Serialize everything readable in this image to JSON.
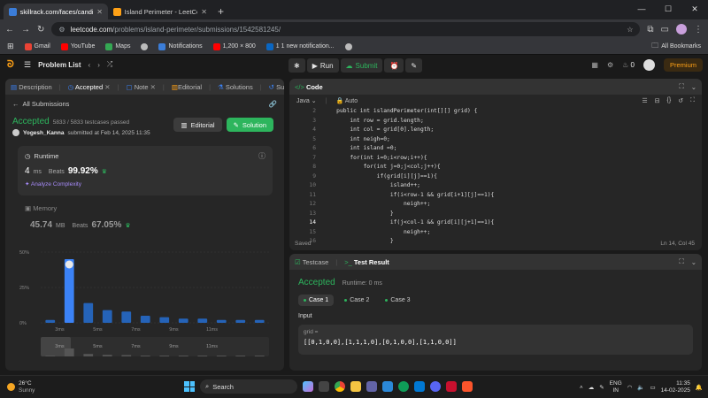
{
  "browser": {
    "tabs": [
      {
        "title": "skillrack.com/faces/candidate/",
        "active": true,
        "color": "#3b7dd8"
      },
      {
        "title": "Island Perimeter - LeetCode",
        "active": false,
        "color": "#ffa116"
      }
    ],
    "url_host": "leetcode.com",
    "url_path": "/problems/island-perimeter/submissions/1542581245/",
    "bookmarks": [
      {
        "label": "Gmail",
        "color": "#ea4335"
      },
      {
        "label": "YouTube",
        "color": "#ff0000"
      },
      {
        "label": "Maps",
        "color": "#34a853"
      },
      {
        "label": "",
        "color": "#bbbbbb"
      },
      {
        "label": "Notifications",
        "color": "#3b7dd8"
      },
      {
        "label": "1,200 × 800",
        "color": "#ff0000"
      },
      {
        "label": "1 1 new notification...",
        "color": "#0a66c2"
      },
      {
        "label": "",
        "color": "#bbbbbb"
      }
    ],
    "all_bookmarks": "All Bookmarks"
  },
  "topnav": {
    "problem_list": "Problem List",
    "run": "Run",
    "submit": "Submit",
    "streak": "0",
    "premium": "Premium"
  },
  "left": {
    "tabs": [
      "Description",
      "Accepted",
      "Note",
      "Editorial",
      "Solutions",
      "Submissions"
    ],
    "all_submissions": "All Submissions",
    "status": "Accepted",
    "testcases": "5833 / 5833 testcases passed",
    "user": "Yogesh_Kanna",
    "submitted": "submitted at Feb 14, 2025 11:35",
    "editorial_btn": "Editorial",
    "solution_btn": "Solution",
    "runtime": {
      "label": "Runtime",
      "value": "4",
      "unit": "ms",
      "beats_label": "Beats",
      "beats": "99.92%",
      "analyze": "Analyze Complexity"
    },
    "memory": {
      "label": "Memory",
      "value": "45.74",
      "unit": "MB",
      "beats_label": "Beats",
      "beats": "67.05%"
    }
  },
  "chart_data": {
    "type": "bar",
    "categories": [
      "1",
      "2",
      "3",
      "4",
      "5",
      "6",
      "7",
      "8",
      "9",
      "10",
      "11",
      "12"
    ],
    "values": [
      2,
      45,
      14,
      9,
      8,
      5,
      4,
      3,
      3,
      2,
      2,
      2
    ],
    "highlight_index": 1,
    "ylim": [
      0,
      50
    ],
    "y_ticks": [
      "50%",
      "25%",
      "0%"
    ],
    "x_tick_labels": [
      "3ms",
      "5ms",
      "7ms",
      "9ms",
      "11ms"
    ],
    "range_labels": [
      "3ms",
      "5ms",
      "7ms",
      "9ms",
      "11ms"
    ]
  },
  "code": {
    "title": "Code",
    "language": "Java",
    "mode": "Auto",
    "start_line": 2,
    "current_line": 14,
    "lines": [
      "    public int islandPerimeter(int[][] grid) {",
      "        int row = grid.length;",
      "        int col = grid[0].length;",
      "        int neigh=0;",
      "        int island =0;",
      "        for(int i=0;i<row;i++){",
      "            for(int j=0;j<col;j++){",
      "                if(grid[i][j]==1){",
      "                    island++;",
      "                    if(i<row-1 && grid[i+1][j]==1){",
      "                        neigh++;",
      "                    }",
      "                    if(j<col-1 && grid[i][j+1]==1){",
      "                        neigh++;",
      "                    }"
    ],
    "saved": "Saved",
    "cursor": "Ln 14, Col 45"
  },
  "testresult": {
    "tab_testcase": "Testcase",
    "tab_result": "Test Result",
    "status": "Accepted",
    "runtime": "Runtime: 0 ms",
    "cases": [
      "Case 1",
      "Case 2",
      "Case 3"
    ],
    "input_label": "Input",
    "var_name": "grid =",
    "var_value": "[[0,1,0,0],[1,1,1,0],[0,1,0,0],[1,1,0,0]]"
  },
  "taskbar": {
    "temp": "26°C",
    "weather": "Sunny",
    "search": "Search",
    "lang1": "ENG",
    "lang2": "IN",
    "time": "11:35",
    "date": "14-02-2025"
  }
}
